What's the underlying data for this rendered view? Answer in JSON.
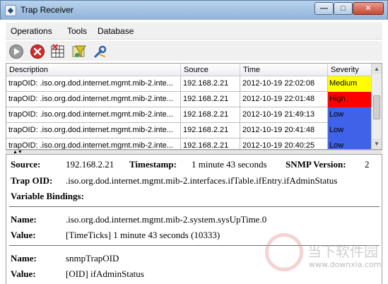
{
  "window": {
    "title": "Trap Receiver",
    "min_glyph": "—",
    "max_glyph": "□",
    "close_glyph": "✕"
  },
  "menu": {
    "items": [
      "Operations",
      "Tools",
      "Database"
    ]
  },
  "toolbar": {
    "icons": [
      "play-icon",
      "stop-icon",
      "grid-icon",
      "filter-icon",
      "wrench-icon"
    ],
    "colors": {
      "play": "#7a7a7a",
      "stop": "#d42a2a",
      "filter": "#d7c21d",
      "wrench": "#2f5fb3"
    }
  },
  "table": {
    "columns": [
      "Description",
      "Source",
      "Time",
      "Severity"
    ],
    "rows": [
      {
        "description": "trapOID: .iso.org.dod.internet.mgmt.mib-2.inte...",
        "source": "192.168.2.21",
        "time": "2012-10-19 22:02:08",
        "severity": "Medium",
        "color": "#ffff00"
      },
      {
        "description": "trapOID: .iso.org.dod.internet.mgmt.mib-2.inte...",
        "source": "192.168.2.21",
        "time": "2012-10-19 22:01:48",
        "severity": "High",
        "color": "#ff0000"
      },
      {
        "description": "trapOID: .iso.org.dod.internet.mgmt.mib-2.inte...",
        "source": "192.168.2.21",
        "time": "2012-10-19 21:49:13",
        "severity": "Low",
        "color": "#3f62e8"
      },
      {
        "description": "trapOID: .iso.org.dod.internet.mgmt.mib-2.inte...",
        "source": "192.168.2.21",
        "time": "2012-10-19 20:41:48",
        "severity": "Low",
        "color": "#3f62e8"
      },
      {
        "description": "trapOID: .iso.org.dod.internet.mgmt.mib-2.inte...",
        "source": "192.168.2.21",
        "time": "2012-10-19 20:40:25",
        "severity": "Low",
        "color": "#3f62e8"
      }
    ]
  },
  "details": {
    "source_label": "Source:",
    "source_value": "192.168.2.21",
    "timestamp_label": "Timestamp:",
    "timestamp_value": "1 minute 43 seconds",
    "snmp_label": "SNMP Version:",
    "snmp_value": "2",
    "trapoid_label": "Trap OID:",
    "trapoid_value": ".iso.org.dod.internet.mgmt.mib-2.interfaces.ifTable.ifEntry.ifAdminStatus",
    "bindings_label": "Variable Bindings:",
    "bindings": [
      {
        "name_label": "Name:",
        "name": ".iso.org.dod.internet.mgmt.mib-2.system.sysUpTime.0",
        "value_label": "Value:",
        "value": "[TimeTicks] 1 minute 43 seconds (10333)"
      },
      {
        "name_label": "Name:",
        "name": "snmpTrapOID",
        "value_label": "Value:",
        "value": "[OID] ifAdminStatus"
      }
    ]
  },
  "watermark": {
    "text": "当下软件园",
    "url": "www.downxia.com"
  }
}
